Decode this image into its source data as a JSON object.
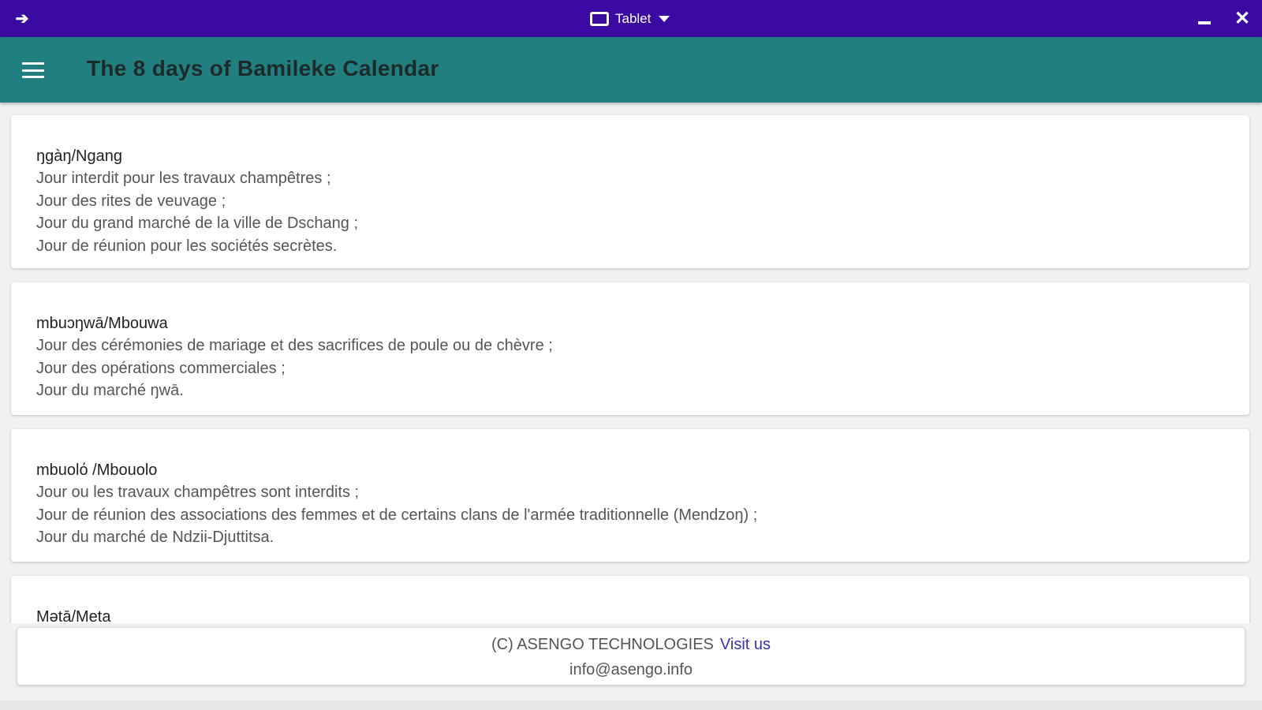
{
  "window": {
    "device_label": "Tablet",
    "icons": {
      "back": "arrow-left-icon",
      "device": "tablet-icon",
      "dropdown": "caret-down-icon",
      "minimize": "minimize-icon",
      "close": "close-icon"
    },
    "colors": {
      "titlebar": "#3b0aa2"
    }
  },
  "appbar": {
    "title": "The 8 days of Bamileke Calendar",
    "menu_icon": "hamburger-menu-icon",
    "colors": {
      "background": "#227f80"
    }
  },
  "days": [
    {
      "title": "ŋgàŋ/Ngang",
      "lines": [
        "Jour interdit pour les travaux champêtres ;",
        "Jour des rites de veuvage ;",
        "Jour du grand marché de la ville de Dschang ;",
        "Jour de réunion pour les sociétés secrètes."
      ]
    },
    {
      "title": "mbuɔŋwā/Mbouwa",
      "lines": [
        "Jour des cérémonies de mariage et des sacrifices de poule ou de chèvre ;",
        "Jour des opérations commerciales ;",
        "Jour du marché  ŋwā."
      ]
    },
    {
      "title": "mbuolό /Mbouolo",
      "lines": [
        "Jour ou les travaux champêtres sont interdits ;",
        "Jour de réunion des associations des femmes et de certains clans de l'armée traditionnelle (Mendzoŋ) ;",
        "Jour du marché de Ndzii-Djuttitsa."
      ]
    },
    {
      "title": "Mətā/Meta",
      "lines": []
    }
  ],
  "footer": {
    "copyright": "(C) ASENGO TECHNOLOGIES",
    "link_label": "Visit us",
    "email": "info@asengo.info",
    "colors": {
      "link": "#3c2fb6"
    }
  }
}
